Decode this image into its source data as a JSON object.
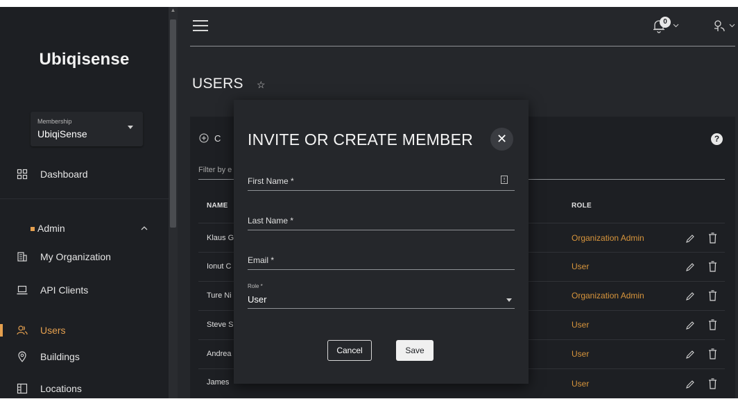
{
  "sidebar": {
    "logo": "Ubiqisense",
    "membership": {
      "label": "Membership",
      "value": "UbiqiSense"
    },
    "dashboard": "Dashboard",
    "admin": "Admin",
    "items": [
      {
        "label": "My Organization",
        "icon": "building-icon"
      },
      {
        "label": "API Clients",
        "icon": "laptop-icon"
      },
      {
        "label": "Users",
        "icon": "users-icon",
        "active": true
      },
      {
        "label": "Buildings",
        "icon": "map-pin-icon"
      },
      {
        "label": "Locations",
        "icon": "floorplan-icon"
      }
    ]
  },
  "topbar": {
    "notification_count": "0"
  },
  "page": {
    "title": "USERS"
  },
  "card": {
    "add_label": "C",
    "filter_placeholder": "Filter by e",
    "columns": {
      "name": "NAME",
      "role": "ROLE"
    },
    "rows": [
      {
        "name": "Klaus G",
        "role": "Organization Admin"
      },
      {
        "name": "Ionut C",
        "role": "User"
      },
      {
        "name": "Ture Ni",
        "role": "Organization Admin"
      },
      {
        "name": "Steve S",
        "role": "User"
      },
      {
        "name": "Andrea",
        "role": "User"
      },
      {
        "name": "James",
        "role": "User"
      }
    ]
  },
  "modal": {
    "title": "INVITE OR CREATE MEMBER",
    "first_name_label": "First Name *",
    "last_name_label": "Last Name *",
    "email_label": "Email *",
    "role_label": "Role *",
    "role_value": "User",
    "cancel_label": "Cancel",
    "save_label": "Save"
  },
  "colors": {
    "accent": "#e5a04f",
    "role_text": "#d8953c",
    "background": "#1d1f23",
    "panel": "#25272b"
  }
}
